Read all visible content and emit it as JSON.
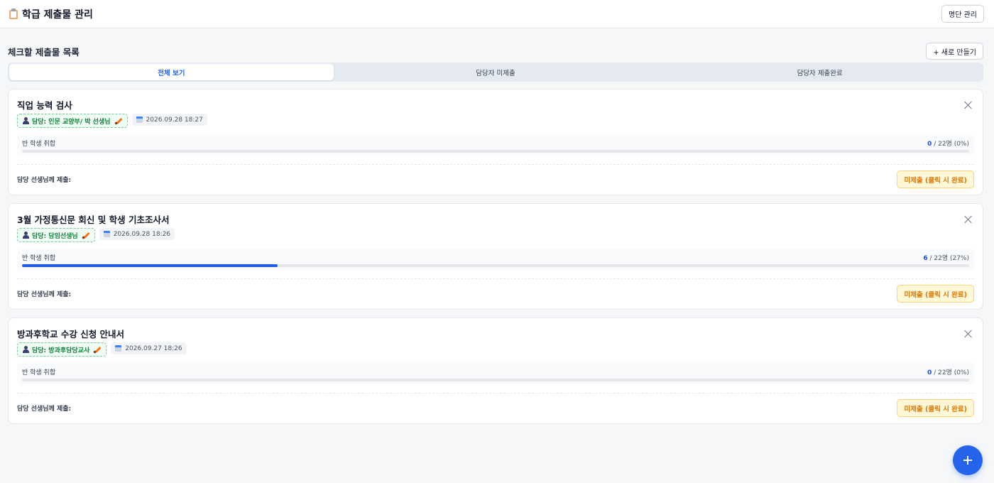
{
  "header": {
    "title": "학급 제출물 관리",
    "roster_button": "명단 관리"
  },
  "section": {
    "title": "체크할 제출물 목록",
    "new_button": "+ 새로 만들기"
  },
  "tabs": [
    {
      "label": "전체 보기",
      "active": true
    },
    {
      "label": "담당자 미제출",
      "active": false
    },
    {
      "label": "담당자 제출완료",
      "active": false
    }
  ],
  "cards": [
    {
      "title": "직업 능력 검사",
      "assignee": "담당: 인문 교양부/ 박 선생님",
      "date": "2026.09.28 18:27",
      "progress_label": "반 학생 취합",
      "submitted": "0",
      "total_text": " / 22명 (0%)",
      "progress_fraction": 0,
      "submit_label": "담당 선생님께 제출:",
      "status_button": "미제출 (클릭 시 완료)"
    },
    {
      "title": "3월 가정통신문 회신 및 학생 기초조사서",
      "assignee": "담당: 담임선생님",
      "date": "2026.09.28 18:26",
      "progress_label": "반 학생 취합",
      "submitted": "6",
      "total_text": " / 22명 (27%)",
      "progress_fraction": 0.27,
      "submit_label": "담당 선생님께 제출:",
      "status_button": "미제출 (클릭 시 완료)"
    },
    {
      "title": "방과후학교 수강 신청 안내서",
      "assignee": "담당: 방과후담당교사",
      "date": "2026.09.27 18:26",
      "progress_label": "반 학생 취합",
      "submitted": "0",
      "total_text": " / 22명 (0%)",
      "progress_fraction": 0,
      "submit_label": "담당 선생님께 제출:",
      "status_button": "미제출 (클릭 시 완료)"
    }
  ],
  "icons": {
    "header": "clipboard-icon",
    "assignee": "person-icon",
    "edit": "pencil-icon",
    "date": "calendar-icon",
    "close": "close-icon",
    "fab": "plus-icon"
  },
  "colors": {
    "accent": "#2563eb",
    "assignee_text": "#15803d",
    "status_text": "#d97706",
    "status_bg": "#fff7d6"
  }
}
